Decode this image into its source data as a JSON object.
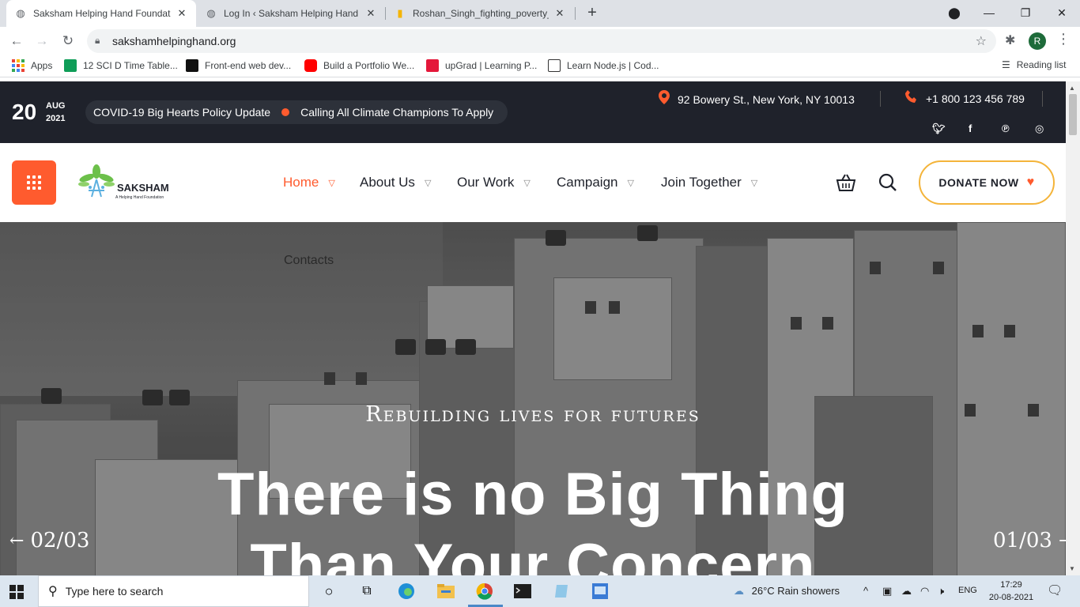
{
  "browser": {
    "tabs": [
      {
        "title": "Saksham Helping Hand Foundati",
        "active": true
      },
      {
        "title": "Log In ‹ Saksham Helping Hand F",
        "active": false
      },
      {
        "title": "Roshan_Singh_fighting_poverty_",
        "active": false
      }
    ],
    "url": "sakshamhelpinghand.org",
    "profile_initial": "R",
    "bookmarks": [
      {
        "label": "Apps"
      },
      {
        "label": "12 SCI D Time Table..."
      },
      {
        "label": "Front-end web dev..."
      },
      {
        "label": "Build a Portfolio We..."
      },
      {
        "label": "upGrad | Learning P..."
      },
      {
        "label": "Learn Node.js | Cod..."
      }
    ],
    "reading_list": "Reading list"
  },
  "topbar": {
    "day": "20",
    "month": "AUG",
    "year": "2021",
    "news": [
      "COVID-19 Big Hearts Policy Update",
      "Calling All Climate Champions To Apply"
    ],
    "address": "92 Bowery St., New York, NY 10013",
    "phone": "+1 800 123 456 789",
    "social_icons": [
      "twitter-icon",
      "facebook-icon",
      "pinterest-icon",
      "instagram-icon"
    ]
  },
  "header": {
    "logo_name": "SAKSHAM",
    "logo_tagline": "A Helping Hand Foundation",
    "nav": [
      {
        "label": "Home",
        "active": true
      },
      {
        "label": "About Us"
      },
      {
        "label": "Our Work"
      },
      {
        "label": "Campaign"
      },
      {
        "label": "Join Together"
      }
    ],
    "donate_label": "DONATE NOW"
  },
  "hero": {
    "submenu_item": "Contacts",
    "kicker": "Rebuilding lives for futures",
    "headline_line1": "There is no Big Thing",
    "headline_line2": "Than Your Concern",
    "prev_slide": "02/03",
    "next_slide": "01/03"
  },
  "taskbar": {
    "search_placeholder": "Type here to search",
    "weather": "26°C  Rain showers",
    "language": "ENG",
    "time": "17:29",
    "date": "20-08-2021"
  },
  "colors": {
    "accent": "#ff5b2e",
    "dark": "#1f222b",
    "donate_border": "#f4b43a"
  }
}
